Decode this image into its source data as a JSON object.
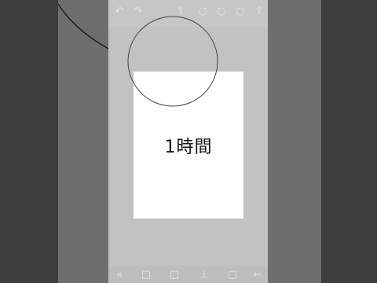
{
  "canvas": {
    "text": "1時間"
  },
  "toolbar": {
    "undo_icon": "↶",
    "redo_icon": "↷",
    "layer_icon": "⇪",
    "tool1_icon": "○",
    "tool2_icon": "○",
    "tool3_icon": "○",
    "export_icon": "⇪"
  },
  "bottombar": {
    "icons": [
      "«",
      "□",
      "□",
      "⊥",
      "▢",
      "←"
    ]
  }
}
